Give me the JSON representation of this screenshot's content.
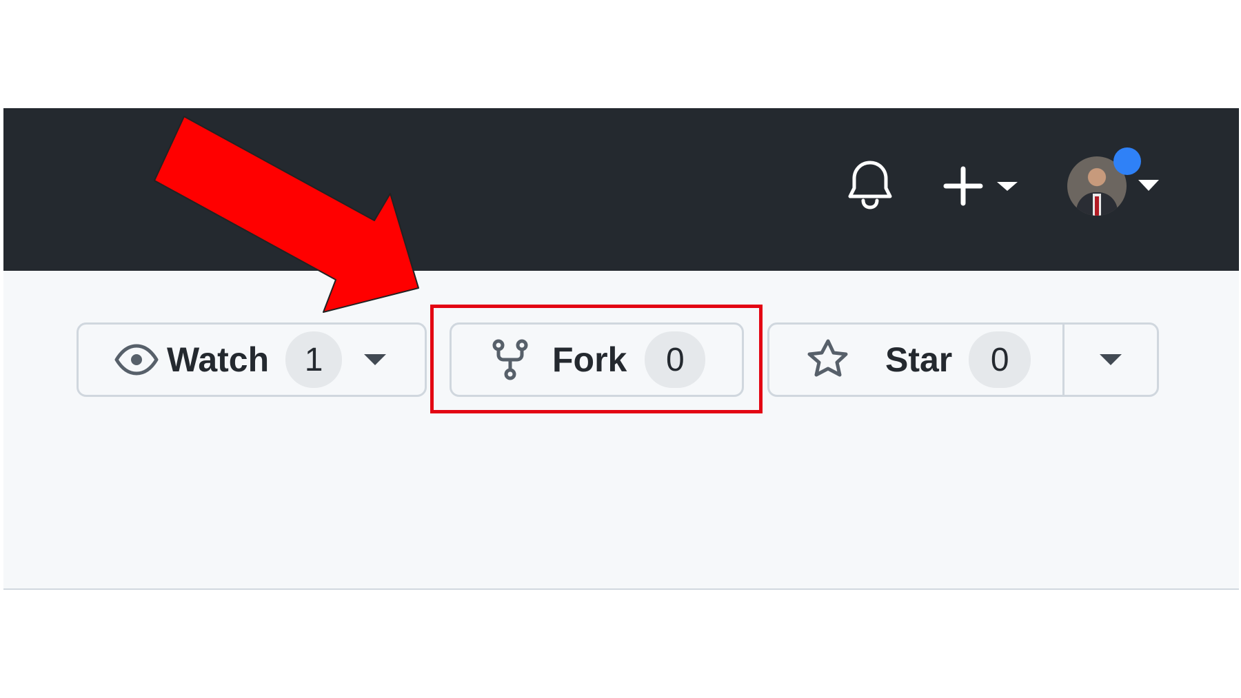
{
  "header": {
    "icons": {
      "bell": "bell-icon",
      "plus": "plus-icon",
      "caret": "triangle-down-icon"
    },
    "accent_color": "#2f81f7"
  },
  "repo_actions": {
    "watch": {
      "label": "Watch",
      "count": "1"
    },
    "fork": {
      "label": "Fork",
      "count": "0"
    },
    "star": {
      "label": "Star",
      "count": "0"
    }
  },
  "annotation": {
    "color": "#e30613"
  }
}
